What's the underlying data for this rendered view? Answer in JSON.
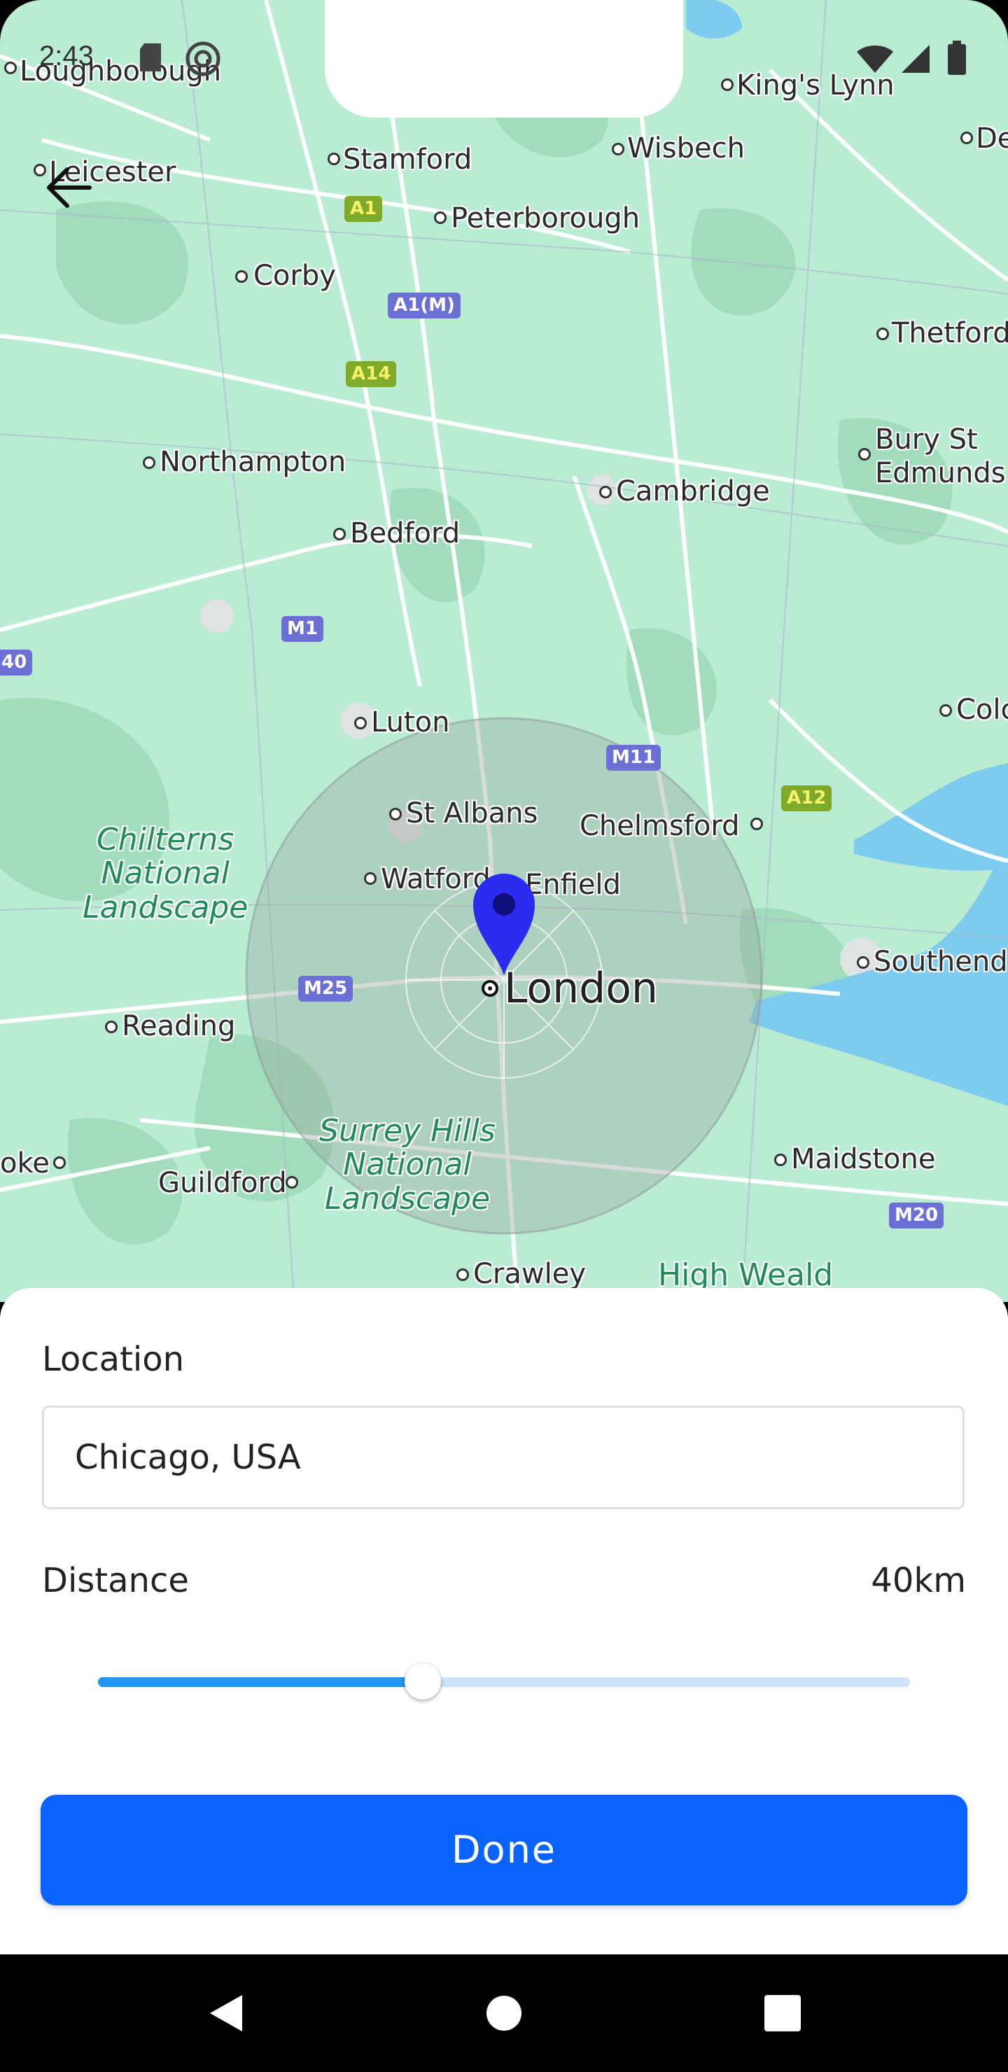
{
  "status_bar": {
    "time": "2:43"
  },
  "map": {
    "cities": [
      {
        "name": "Loughborough"
      },
      {
        "name": "Leicester"
      },
      {
        "name": "Stamford"
      },
      {
        "name": "Peterborough"
      },
      {
        "name": "King's Lynn"
      },
      {
        "name": "Wisbech"
      },
      {
        "name": "De"
      },
      {
        "name": "Corby"
      },
      {
        "name": "Thetford"
      },
      {
        "name": "Northampton"
      },
      {
        "name": "Bury St\nEdmunds"
      },
      {
        "name": "Cambridge"
      },
      {
        "name": "Bedford"
      },
      {
        "name": "Luton"
      },
      {
        "name": "Colc"
      },
      {
        "name": "St Albans"
      },
      {
        "name": "Chelmsford"
      },
      {
        "name": "Watford"
      },
      {
        "name": "Enfield"
      },
      {
        "name": "Southend"
      },
      {
        "name": "Reading"
      },
      {
        "name": "oke"
      },
      {
        "name": "Guildford"
      },
      {
        "name": "Maidstone"
      },
      {
        "name": "Crawley"
      }
    ],
    "center_city": "London",
    "parks": [
      "Chilterns\nNational\nLandscape",
      "Surrey Hills\nNational\nLandscape",
      "High Weald"
    ],
    "road_shields": [
      "A1",
      "A1(M)",
      "A14",
      "M1",
      "M11",
      "A12",
      "M25",
      "M20",
      "40"
    ],
    "radius_circle": true,
    "pin_color": "#2b2bef"
  },
  "sheet": {
    "location_label": "Location",
    "location_value": "Chicago, USA",
    "distance_label": "Distance",
    "distance_value": "40km",
    "distance_slider_fraction": 0.4,
    "done_label": "Done",
    "accent": "#0b63ff"
  }
}
